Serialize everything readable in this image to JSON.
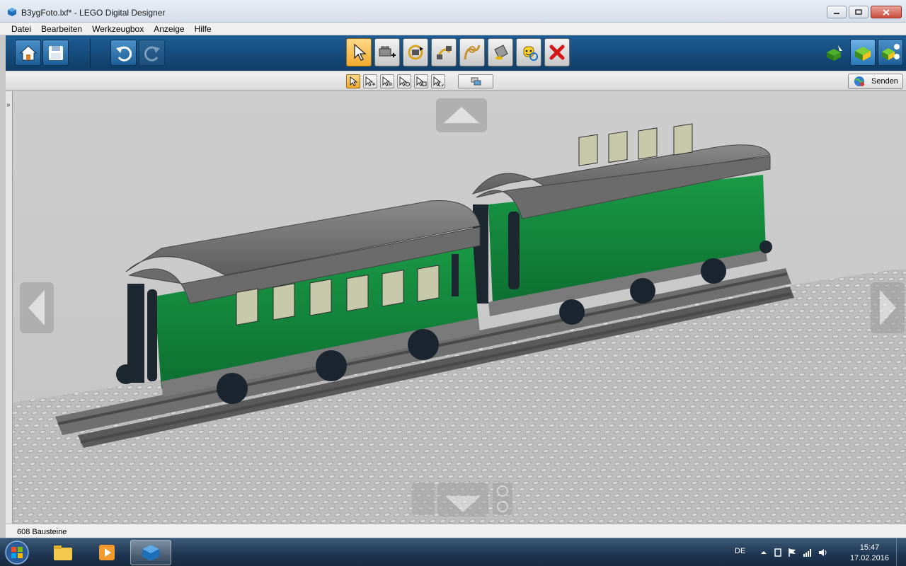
{
  "window": {
    "title": "B3ygFoto.lxf* - LEGO Digital Designer"
  },
  "menu": {
    "items": [
      "Datei",
      "Bearbeiten",
      "Werkzeugbox",
      "Anzeige",
      "Hilfe"
    ]
  },
  "toolbar": {
    "left_icons": [
      "home-icon",
      "save-icon",
      "undo-icon",
      "redo-icon"
    ],
    "tools": [
      "select-icon",
      "clone-icon",
      "hinge-icon",
      "hinge-align-icon",
      "flex-icon",
      "paint-icon",
      "minifig-icon",
      "delete-icon"
    ],
    "right_icons": [
      "build-mode-icon",
      "view-mode-icon",
      "building-guide-icon"
    ]
  },
  "subtoolbar": {
    "send_label": "Senden"
  },
  "status": {
    "brick_count": "608 Bausteine"
  },
  "taskbar": {
    "language": "DE",
    "time": "15:47",
    "date": "17.02.2016"
  },
  "colors": {
    "toolbar_blue": "#1a5288",
    "wagon_green": "#13803a",
    "roof_gray": "#707070",
    "active_tool": "#f0a92c"
  }
}
